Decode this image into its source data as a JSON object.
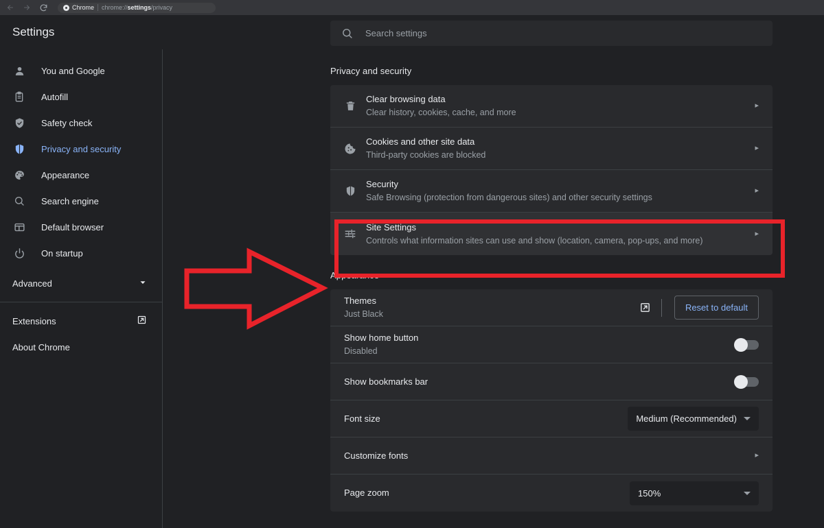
{
  "browser": {
    "back_icon": "back-arrow-icon",
    "forward_icon": "forward-arrow-icon",
    "reload_icon": "reload-icon",
    "omnibox": {
      "chip_label": "Chrome",
      "url_prefix": "chrome://",
      "url_bold": "settings",
      "url_suffix": "/privacy",
      "full_url": "chrome://settings/privacy"
    }
  },
  "header": {
    "title": "Settings",
    "search_placeholder": "Search settings",
    "search_value": ""
  },
  "sidebar": {
    "items": [
      {
        "label": "You and Google",
        "icon": "person-icon",
        "active": false
      },
      {
        "label": "Autofill",
        "icon": "clipboard-icon",
        "active": false
      },
      {
        "label": "Safety check",
        "icon": "shield-check-icon",
        "active": false
      },
      {
        "label": "Privacy and security",
        "icon": "shield-icon",
        "active": true
      },
      {
        "label": "Appearance",
        "icon": "palette-icon",
        "active": false
      },
      {
        "label": "Search engine",
        "icon": "search-icon",
        "active": false
      },
      {
        "label": "Default browser",
        "icon": "browser-window-icon",
        "active": false
      },
      {
        "label": "On startup",
        "icon": "power-icon",
        "active": false
      }
    ],
    "advanced": {
      "label": "Advanced",
      "icon": "chevron-down-icon"
    },
    "footer": [
      {
        "label": "Extensions",
        "icon": "external-link-icon"
      },
      {
        "label": "About Chrome",
        "icon": ""
      }
    ]
  },
  "main": {
    "privacy_section": {
      "title": "Privacy and security",
      "rows": [
        {
          "title": "Clear browsing data",
          "subtitle": "Clear history, cookies, cache, and more",
          "icon": "trash-icon",
          "chevron": "▸",
          "highlighted": false
        },
        {
          "title": "Cookies and other site data",
          "subtitle": "Third-party cookies are blocked",
          "icon": "cookie-icon",
          "chevron": "▸",
          "highlighted": false
        },
        {
          "title": "Security",
          "subtitle": "Safe Browsing (protection from dangerous sites) and other security settings",
          "icon": "shield-icon",
          "chevron": "▸",
          "highlighted": false
        },
        {
          "title": "Site Settings",
          "subtitle": "Controls what information sites can use and show (location, camera, pop-ups, and more)",
          "icon": "sliders-icon",
          "chevron": "▸",
          "highlighted": true
        }
      ]
    },
    "appearance_section": {
      "title": "Appearance",
      "themes": {
        "title": "Themes",
        "subtitle": "Just Black",
        "external_icon": "external-link-icon",
        "reset_label": "Reset to default"
      },
      "home_button": {
        "title": "Show home button",
        "subtitle": "Disabled",
        "toggle_state": "off"
      },
      "bookmarks_bar": {
        "title": "Show bookmarks bar",
        "toggle_state": "off"
      },
      "font_size": {
        "title": "Font size",
        "value": "Medium (Recommended)"
      },
      "customize_fonts": {
        "title": "Customize fonts",
        "chevron": "▸"
      },
      "page_zoom": {
        "title": "Page zoom",
        "value": "150%"
      }
    }
  },
  "annotations": {
    "arrow": {
      "name": "red-pointer-arrow",
      "color": "#e8232a"
    },
    "box": {
      "name": "red-highlight-box",
      "color": "#e8232a",
      "targets": "Site Settings"
    }
  }
}
